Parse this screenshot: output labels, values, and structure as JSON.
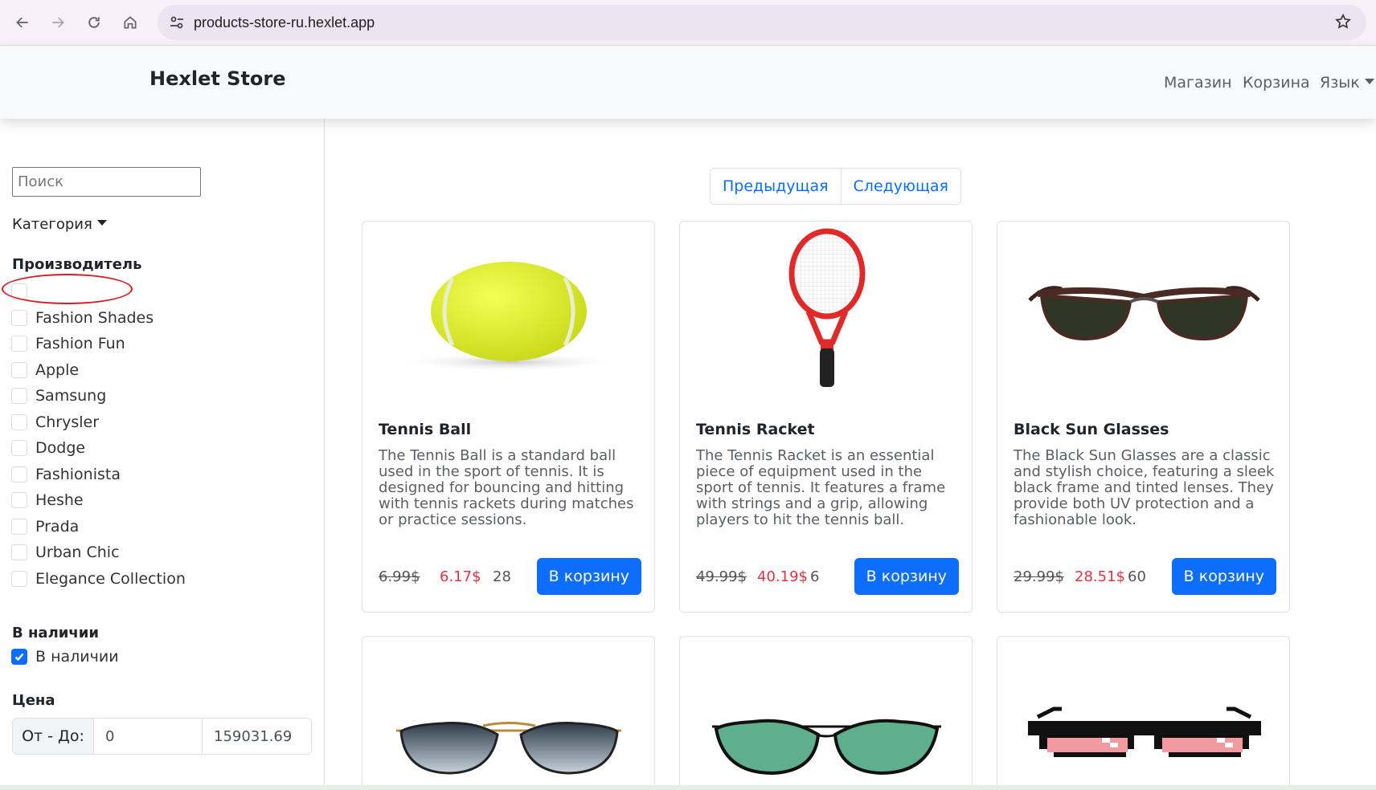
{
  "browser": {
    "url": "products-store-ru.hexlet.app"
  },
  "navbar": {
    "brand": "Hexlet Store",
    "links": [
      "Магазин",
      "Корзина",
      "Язык"
    ]
  },
  "sidebar": {
    "search_placeholder": "Поиск",
    "category_label": "Категория",
    "manufacturer_title": "Производитель",
    "manufacturers": [
      {
        "label": "",
        "checked": false
      },
      {
        "label": "Fashion Shades",
        "checked": false
      },
      {
        "label": "Fashion Fun",
        "checked": false
      },
      {
        "label": "Apple",
        "checked": false
      },
      {
        "label": "Samsung",
        "checked": false
      },
      {
        "label": "Chrysler",
        "checked": false
      },
      {
        "label": "Dodge",
        "checked": false
      },
      {
        "label": "Fashionista",
        "checked": false
      },
      {
        "label": "Heshe",
        "checked": false
      },
      {
        "label": "Prada",
        "checked": false
      },
      {
        "label": "Urban Chic",
        "checked": false
      },
      {
        "label": "Elegance Collection",
        "checked": false
      }
    ],
    "stock_title": "В наличии",
    "stock_label": "В наличии",
    "stock_checked": true,
    "price_title": "Цена",
    "price_label": "От - До:",
    "price_from": "0",
    "price_to": "159031.69"
  },
  "pagination": {
    "prev": "Предыдущая",
    "next": "Следующая"
  },
  "products": [
    {
      "title": "Tennis Ball",
      "description": "The Tennis Ball is a standard ball used in the sport of tennis. It is designed for bouncing and hitting with tennis rackets during matches or practice sessions.",
      "old_price": "6.99$",
      "price": "6.17$",
      "stock": "28",
      "button": "В корзину",
      "image": "tennis-ball"
    },
    {
      "title": "Tennis Racket",
      "description": "The Tennis Racket is an essential piece of equipment used in the sport of tennis. It features a frame with strings and a grip, allowing players to hit the tennis ball.",
      "old_price": "49.99$",
      "price": "40.19$",
      "stock": "6",
      "button": "В корзину",
      "image": "tennis-racket"
    },
    {
      "title": "Black Sun Glasses",
      "description": "The Black Sun Glasses are a classic and stylish choice, featuring a sleek black frame and tinted lenses. They provide both UV protection and a fashionable look.",
      "old_price": "29.99$",
      "price": "28.51$",
      "stock": "60",
      "button": "В корзину",
      "image": "black-sunglasses"
    },
    {
      "image": "aviator-sunglasses"
    },
    {
      "image": "green-sunglasses"
    },
    {
      "image": "pixel-sunglasses"
    }
  ],
  "colors": {
    "primary": "#0d6efd",
    "sale": "#dc3545",
    "annotation": "#d81b23"
  }
}
